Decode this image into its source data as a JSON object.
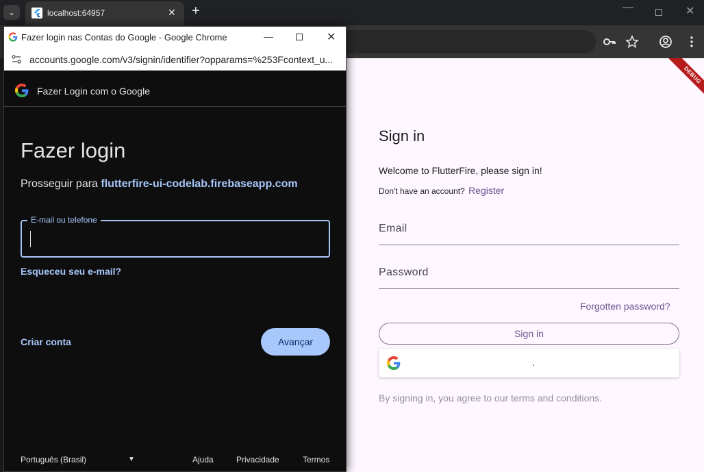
{
  "browser": {
    "tab_title": "localhost:64957",
    "tab_close": "✕",
    "new_tab": "+",
    "tab_search": "⌄",
    "win_min": "—",
    "win_close": "✕"
  },
  "app": {
    "debug_banner": "DEBUG",
    "title": "Sign in",
    "welcome": "Welcome to FlutterFire, please sign in!",
    "no_account": "Don't have an account?",
    "register": "Register",
    "email_label": "Email",
    "password_label": "Password",
    "forgot_password": "Forgotten password?",
    "sign_in_button": "Sign in",
    "google_button_text": ".",
    "terms": "By signing in, you agree to our terms and conditions."
  },
  "popup": {
    "window_title": "Fazer login nas Contas do Google - Google Chrome",
    "url": "accounts.google.com/v3/signin/identifier?opparams=%253Fcontext_u...",
    "header": "Fazer Login com o Google",
    "heading": "Fazer login",
    "continue_prefix": "Prosseguir para",
    "continue_link": "flutterfire-ui-codelab.firebaseapp.com",
    "input_label": "E-mail ou telefone",
    "input_value": "",
    "forgot_email": "Esqueceu seu e-mail?",
    "create_account": "Criar conta",
    "next_button": "Avançar",
    "language": "Português (Brasil)",
    "footer_links": [
      "Ajuda",
      "Privacidade",
      "Termos"
    ]
  },
  "colors": {
    "accent_blue": "#a8c7fa",
    "flutter_purple": "#65558f",
    "app_background": "#fef7ff",
    "popup_background": "#0e0e0f"
  },
  "icons": [
    "chevron-down-icon",
    "flutter-favicon",
    "key-icon",
    "star-icon",
    "account-icon",
    "kebab-menu-icon",
    "google-favicon",
    "site-settings-icon",
    "google-g-icon"
  ]
}
